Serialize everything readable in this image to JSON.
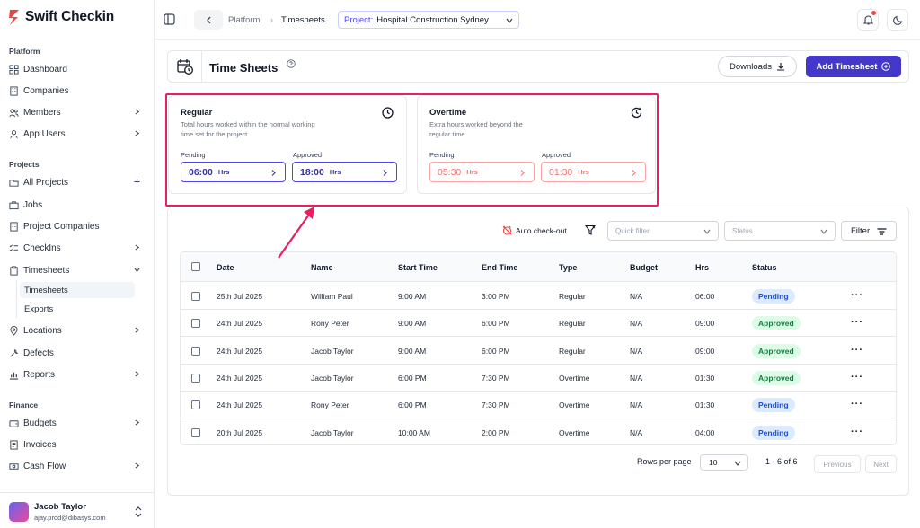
{
  "brand": {
    "name": "Swift Checkin",
    "accent": "#ef4444"
  },
  "sidebar": {
    "sections": {
      "platform": "Platform",
      "projects": "Projects",
      "finance": "Finance"
    },
    "items": [
      {
        "label": "Dashboard",
        "icon": "grid-icon"
      },
      {
        "label": "Companies",
        "icon": "building-icon"
      },
      {
        "label": "Members",
        "icon": "users-icon"
      },
      {
        "label": "App Users",
        "icon": "user-icon"
      },
      {
        "label": "All Projects",
        "icon": "folder-icon"
      },
      {
        "label": "Jobs",
        "icon": "briefcase-icon"
      },
      {
        "label": "Project Companies",
        "icon": "building-icon"
      },
      {
        "label": "CheckIns",
        "icon": "list-check-icon"
      },
      {
        "label": "Timesheets",
        "icon": "clipboard-icon"
      },
      {
        "label": "Locations",
        "icon": "map-pin-icon"
      },
      {
        "label": "Defects",
        "icon": "wrench-icon"
      },
      {
        "label": "Reports",
        "icon": "chart-icon"
      },
      {
        "label": "Budgets",
        "icon": "wallet-icon"
      },
      {
        "label": "Invoices",
        "icon": "receipt-icon"
      },
      {
        "label": "Cash Flow",
        "icon": "cash-icon"
      }
    ],
    "sub_items": [
      "Timesheets",
      "Exports"
    ],
    "user": {
      "name": "Jacob Taylor",
      "email": "ajay.prod@dibasys.com"
    }
  },
  "topbar": {
    "breadcrumb": [
      "Platform",
      "Timesheets"
    ],
    "project_label": "Project:",
    "project_value": "Hospital Construction Sydney"
  },
  "header": {
    "title": "Time Sheets",
    "downloads_label": "Downloads",
    "add_label": "Add Timesheet",
    "primary_color": "#4338ca"
  },
  "summary": {
    "regular": {
      "title": "Regular",
      "description": "Total hours worked within the normal working time set for the project",
      "pending_label": "Pending",
      "pending_value": "06:00",
      "approved_label": "Approved",
      "approved_value": "18:00",
      "unit": "Hrs"
    },
    "overtime": {
      "title": "Overtime",
      "description": "Extra hours worked beyond the regular time.",
      "pending_label": "Pending",
      "pending_value": "05:30",
      "approved_label": "Approved",
      "approved_value": "01:30",
      "unit": "Hrs"
    },
    "highlight_color": "#e91e63"
  },
  "toolbar": {
    "auto_checkout": "Auto check-out",
    "quick_filter_placeholder": "Quick filter",
    "status_placeholder": "Status",
    "filter_label": "Filter"
  },
  "table": {
    "columns": [
      "Date",
      "Name",
      "Start Time",
      "End Time",
      "Type",
      "Budget",
      "Hrs",
      "Status"
    ],
    "rows": [
      {
        "date": "25th Jul 2025",
        "name": "William Paul",
        "start": "9:00 AM",
        "end": "3:00 PM",
        "type": "Regular",
        "budget": "N/A",
        "hrs": "06:00",
        "status": "Pending"
      },
      {
        "date": "24th Jul 2025",
        "name": "Rony Peter",
        "start": "9:00 AM",
        "end": "6:00 PM",
        "type": "Regular",
        "budget": "N/A",
        "hrs": "09:00",
        "status": "Approved"
      },
      {
        "date": "24th Jul 2025",
        "name": "Jacob Taylor",
        "start": "9:00 AM",
        "end": "6:00 PM",
        "type": "Regular",
        "budget": "N/A",
        "hrs": "09:00",
        "status": "Approved"
      },
      {
        "date": "24th Jul 2025",
        "name": "Jacob Taylor",
        "start": "6:00 PM",
        "end": "7:30 PM",
        "type": "Overtime",
        "budget": "N/A",
        "hrs": "01:30",
        "status": "Approved"
      },
      {
        "date": "24th Jul 2025",
        "name": "Rony Peter",
        "start": "6:00 PM",
        "end": "7:30 PM",
        "type": "Overtime",
        "budget": "N/A",
        "hrs": "01:30",
        "status": "Pending"
      },
      {
        "date": "20th Jul 2025",
        "name": "Jacob Taylor",
        "start": "10:00 AM",
        "end": "2:00 PM",
        "type": "Overtime",
        "budget": "N/A",
        "hrs": "04:00",
        "status": "Pending"
      }
    ]
  },
  "pagination": {
    "rows_per_page_label": "Rows per page",
    "rows_per_page_value": "10",
    "range": "1 - 6 of 6",
    "previous": "Previous",
    "next": "Next"
  }
}
